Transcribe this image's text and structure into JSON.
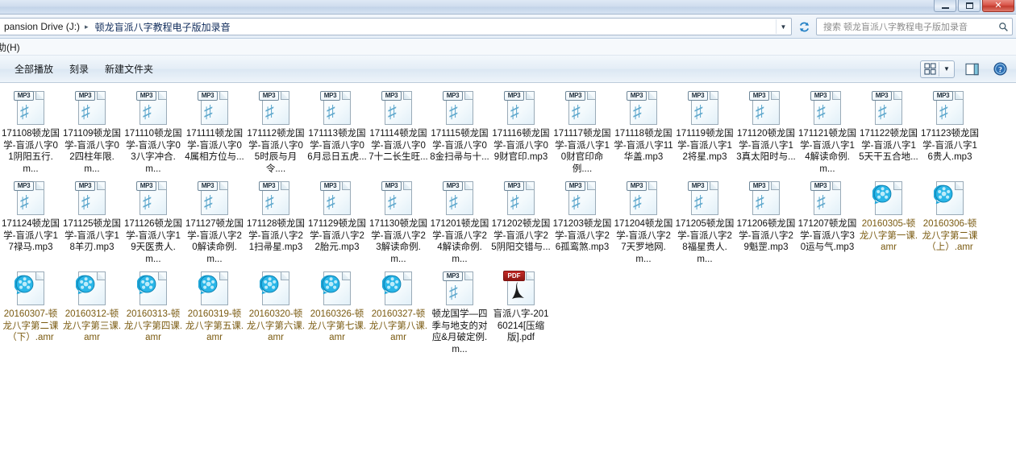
{
  "window": {
    "controls": [
      {
        "name": "minimize",
        "label": "–"
      },
      {
        "name": "maximize",
        "label": "□"
      },
      {
        "name": "close",
        "label": "✕"
      }
    ]
  },
  "address": {
    "crumbs": [
      "pansion Drive (J:)",
      "顿龙盲派八字教程电子版加录音"
    ],
    "separator": "▸",
    "dropdown_caret": "▼",
    "refresh_label": "↻"
  },
  "search": {
    "placeholder": "搜索 顿龙盲派八字教程电子版加录音",
    "icon": "🔍"
  },
  "menubar": {
    "items": [
      "助(H)"
    ]
  },
  "toolbar": {
    "items": [
      "全部播放",
      "刻录",
      "新建文件夹"
    ],
    "view_caret": "▼",
    "help_label": "?"
  },
  "files": [
    {
      "type": "mp3",
      "name": "171108顿龙国学-盲派八字01阴阳五行.m..."
    },
    {
      "type": "mp3",
      "name": "171109顿龙国学-盲派八字02四柱年限.m..."
    },
    {
      "type": "mp3",
      "name": "171110顿龙国学-盲派八字03八字冲合.m..."
    },
    {
      "type": "mp3",
      "name": "171111顿龙国学-盲派八字04属相方位与..."
    },
    {
      "type": "mp3",
      "name": "171112顿龙国学-盲派八字05时辰与月令...."
    },
    {
      "type": "mp3",
      "name": "171113顿龙国学-盲派八字06月忌日五虎..."
    },
    {
      "type": "mp3",
      "name": "171114顿龙国学-盲派八字07十二长生旺..."
    },
    {
      "type": "mp3",
      "name": "171115顿龙国学-盲派八字08金扫帚与十..."
    },
    {
      "type": "mp3",
      "name": "171116顿龙国学-盲派八字09财官印.mp3"
    },
    {
      "type": "mp3",
      "name": "171117顿龙国学-盲派八字10财官印命例...."
    },
    {
      "type": "mp3",
      "name": "171118顿龙国学-盲派八字11华盖.mp3"
    },
    {
      "type": "mp3",
      "name": "171119顿龙国学-盲派八字12将星.mp3"
    },
    {
      "type": "mp3",
      "name": "171120顿龙国学-盲派八字13真太阳时与..."
    },
    {
      "type": "mp3",
      "name": "171121顿龙国学-盲派八字14解读命例.m..."
    },
    {
      "type": "mp3",
      "name": "171122顿龙国学-盲派八字15天干五合地..."
    },
    {
      "type": "mp3",
      "name": "171123顿龙国学-盲派八字16贵人.mp3"
    },
    {
      "type": "mp3",
      "name": "171124顿龙国学-盲派八字17禄马.mp3"
    },
    {
      "type": "mp3",
      "name": "171125顿龙国学-盲派八字18羊刃.mp3"
    },
    {
      "type": "mp3",
      "name": "171126顿龙国学-盲派八字19天医贵人.m..."
    },
    {
      "type": "mp3",
      "name": "171127顿龙国学-盲派八字20解读命例.m..."
    },
    {
      "type": "mp3",
      "name": "171128顿龙国学-盲派八字21扫帚星.mp3"
    },
    {
      "type": "mp3",
      "name": "171129顿龙国学-盲派八字22胎元.mp3"
    },
    {
      "type": "mp3",
      "name": "171130顿龙国学-盲派八字23解读命例.m..."
    },
    {
      "type": "mp3",
      "name": "171201顿龙国学-盲派八字24解读命例.m..."
    },
    {
      "type": "mp3",
      "name": "171202顿龙国学-盲派八字25阴阳交错与..."
    },
    {
      "type": "mp3",
      "name": "171203顿龙国学-盲派八字26孤鸾煞.mp3"
    },
    {
      "type": "mp3",
      "name": "171204顿龙国学-盲派八字27天罗地网.m..."
    },
    {
      "type": "mp3",
      "name": "171205顿龙国学-盲派八字28福星贵人.m..."
    },
    {
      "type": "mp3",
      "name": "171206顿龙国学-盲派八字29魁罡.mp3"
    },
    {
      "type": "mp3",
      "name": "171207顿龙国学-盲派八字30运与气.mp3"
    },
    {
      "type": "amr",
      "name": "20160305-顿龙八字第一课.amr"
    },
    {
      "type": "amr",
      "name": "20160306-顿龙八字第二课（上）.amr"
    },
    {
      "type": "amr",
      "name": "20160307-顿龙八字第二课（下）.amr"
    },
    {
      "type": "amr",
      "name": "20160312-顿龙八字第三课.amr"
    },
    {
      "type": "amr",
      "name": "20160313-顿龙八字第四课.amr"
    },
    {
      "type": "amr",
      "name": "20160319-顿龙八字第五课.amr"
    },
    {
      "type": "amr",
      "name": "20160320-顿龙八字第六课.amr"
    },
    {
      "type": "amr",
      "name": "20160326-顿龙八字第七课.amr"
    },
    {
      "type": "amr",
      "name": "20160327-顿龙八字第八课.amr"
    },
    {
      "type": "mp3",
      "name": "顿龙国学—四季与地支的对应&月破定例.m..."
    },
    {
      "type": "pdf",
      "name": "盲派八字-20160214[压缩版].pdf"
    }
  ],
  "icon_labels": {
    "mp3_badge": "MP3",
    "pdf_badge": "PDF",
    "mp3_note": "♫",
    "pdf_glyph": "A"
  }
}
